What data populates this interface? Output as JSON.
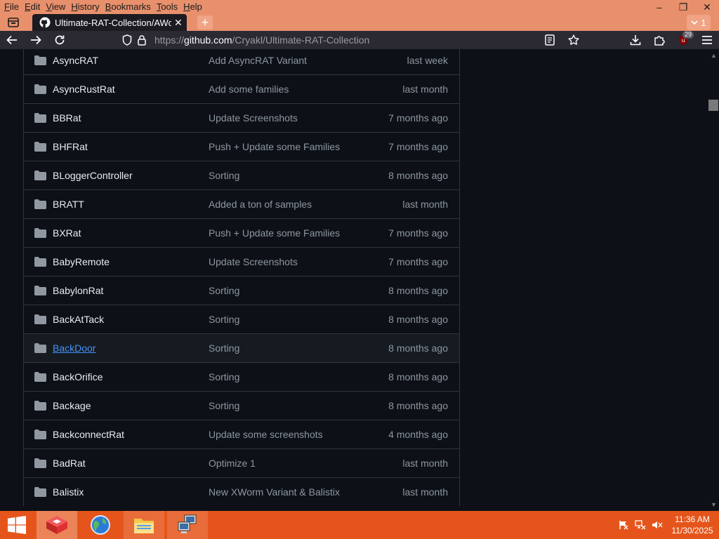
{
  "menubar": {
    "items": [
      "File",
      "Edit",
      "View",
      "History",
      "Bookmarks",
      "Tools",
      "Help"
    ]
  },
  "window_controls": {
    "minimize": "–",
    "restore": "❐",
    "close": "✕"
  },
  "tab": {
    "title": "Ultimate-RAT-Collection/AWorm",
    "close": "✕"
  },
  "new_tab": "+",
  "tab_list": {
    "count": "1"
  },
  "urlbar": {
    "prefix": "https://",
    "host": "github.com",
    "path": "/Cryakl/Ultimate-RAT-Collection"
  },
  "toolbar": {
    "ublock_badge": "29"
  },
  "files": [
    {
      "name": "AsyncRAT",
      "message": "Add AsyncRAT Variant",
      "age": "last week"
    },
    {
      "name": "AsyncRustRat",
      "message": "Add some families",
      "age": "last month"
    },
    {
      "name": "BBRat",
      "message": "Update Screenshots",
      "age": "7 months ago"
    },
    {
      "name": "BHFRat",
      "message": "Push + Update some Families",
      "age": "7 months ago"
    },
    {
      "name": "BLoggerController",
      "message": "Sorting",
      "age": "8 months ago"
    },
    {
      "name": "BRATT",
      "message": "Added a ton of samples",
      "age": "last month"
    },
    {
      "name": "BXRat",
      "message": "Push + Update some Families",
      "age": "7 months ago"
    },
    {
      "name": "BabyRemote",
      "message": "Update Screenshots",
      "age": "7 months ago"
    },
    {
      "name": "BabylonRat",
      "message": "Sorting",
      "age": "8 months ago"
    },
    {
      "name": "BackAtTack",
      "message": "Sorting",
      "age": "8 months ago"
    },
    {
      "name": "BackDoor",
      "message": "Sorting",
      "age": "8 months ago",
      "hover": true
    },
    {
      "name": "BackOrifice",
      "message": "Sorting",
      "age": "8 months ago"
    },
    {
      "name": "Backage",
      "message": "Sorting",
      "age": "8 months ago"
    },
    {
      "name": "BackconnectRat",
      "message": "Update some screenshots",
      "age": "4 months ago"
    },
    {
      "name": "BadRat",
      "message": "Optimize 1",
      "age": "last month"
    },
    {
      "name": "Balistix",
      "message": "New XWorm Variant & Balistix",
      "age": "last month"
    }
  ],
  "taskbar": {
    "apps": [
      "start-menu",
      "app-red-cube",
      "browser-globe",
      "file-explorer",
      "network-computer"
    ]
  },
  "clock": {
    "time": "11:36 AM",
    "date": "11/30/2025"
  },
  "colors": {
    "page_bg": "#0d1117",
    "border": "#30363d",
    "text": "#e6edf3",
    "muted": "#8d96a0",
    "link": "#4493f8",
    "folder": "#9198a1",
    "chrome": "#e8906c",
    "taskbar": "#e5551b"
  }
}
